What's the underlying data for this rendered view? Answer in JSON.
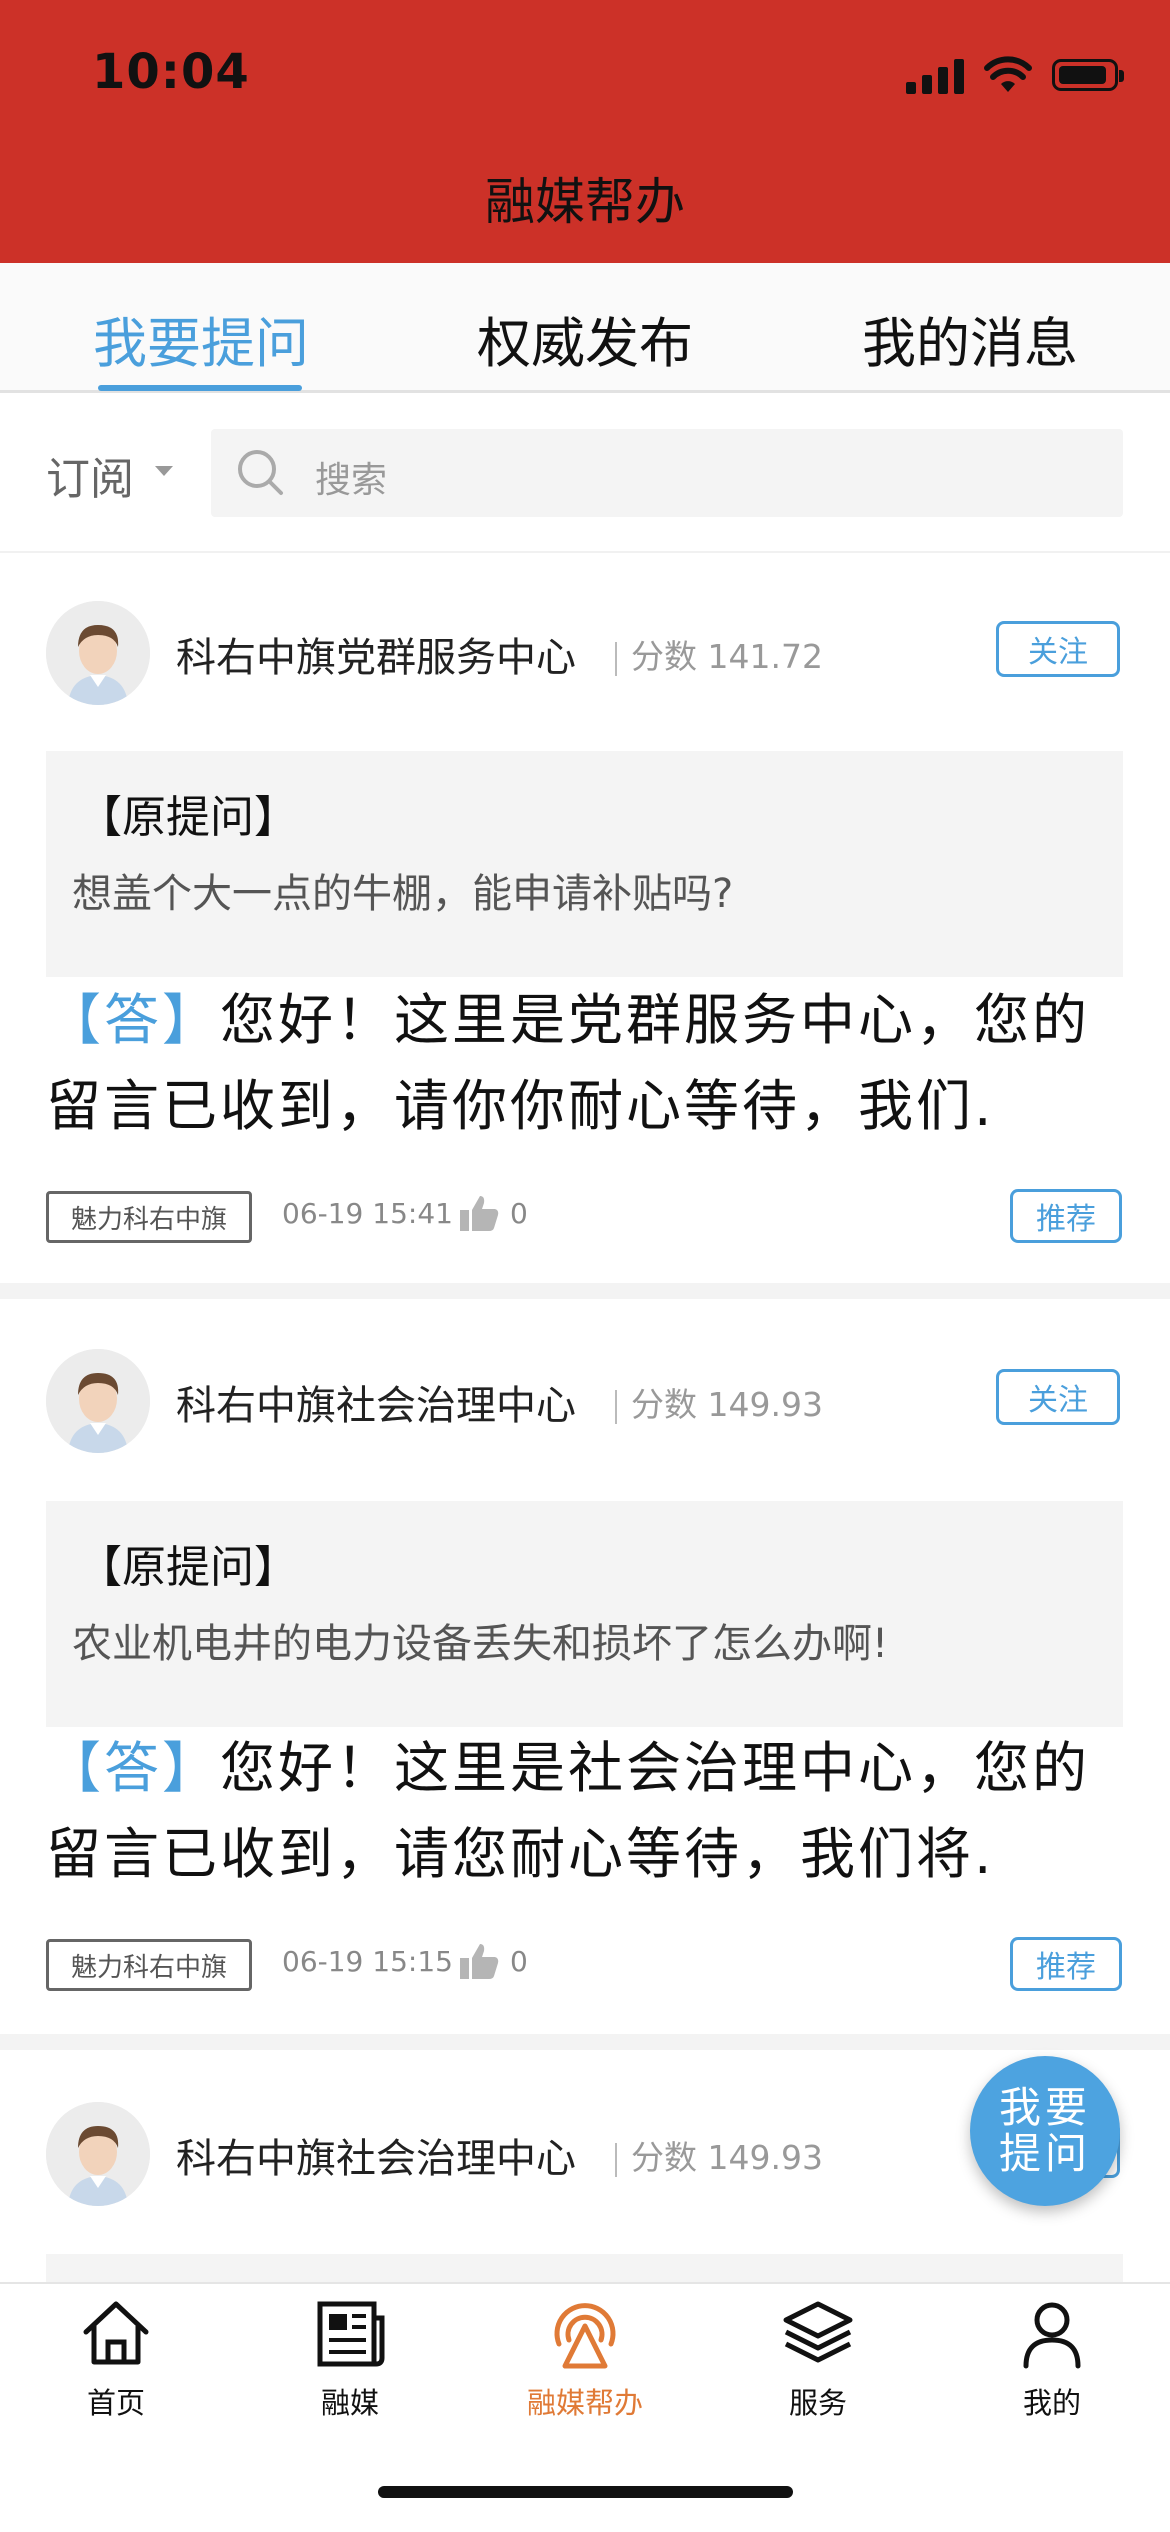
{
  "status_bar": {
    "time": "10:04"
  },
  "header": {
    "title": "融媒帮办"
  },
  "tabs": [
    {
      "label": "我要提问",
      "active": true
    },
    {
      "label": "权威发布",
      "active": false
    },
    {
      "label": "我的消息",
      "active": false
    }
  ],
  "filter": {
    "subscribe_label": "订阅",
    "search_placeholder": "搜索"
  },
  "cards": [
    {
      "org": "科右中旗党群服务中心",
      "score": "分数 141.72",
      "follow_label": "关注",
      "question_label": "【原提问】",
      "question": "想盖个大一点的牛棚，能申请补贴吗?",
      "answer_tag": "【答】",
      "answer_line1": "您好！这里是党群服务中心，您的",
      "answer_line2": "留言已收到，请你你耐心等待，我们.",
      "tag": "魅力科右中旗",
      "time": "06-19 15:41",
      "likes": "0",
      "recommend_label": "推荐"
    },
    {
      "org": "科右中旗社会治理中心",
      "score": "分数 149.93",
      "follow_label": "关注",
      "question_label": "【原提问】",
      "question": "农业机电井的电力设备丢失和损坏了怎么办啊!",
      "answer_tag": "【答】",
      "answer_line1": "您好！这里是社会治理中心，您的",
      "answer_line2": "留言已收到，请您耐心等待，我们将.",
      "tag": "魅力科右中旗",
      "time": "06-19 15:15",
      "likes": "0",
      "recommend_label": "推荐"
    },
    {
      "org": "科右中旗社会治理中心",
      "score": "分数 149.93"
    }
  ],
  "fab": {
    "line1": "我要",
    "line2": "提问"
  },
  "bottom_nav": [
    {
      "label": "首页",
      "icon": "home-icon",
      "active": false
    },
    {
      "label": "融媒",
      "icon": "newspaper-icon",
      "active": false
    },
    {
      "label": "融媒帮办",
      "icon": "broadcast-icon",
      "active": true
    },
    {
      "label": "服务",
      "icon": "layers-icon",
      "active": false
    },
    {
      "label": "我的",
      "icon": "person-icon",
      "active": false
    }
  ],
  "colors": {
    "header_bg": "#cc3128",
    "accent": "#4a9fdc",
    "nav_active": "#e07a36"
  }
}
